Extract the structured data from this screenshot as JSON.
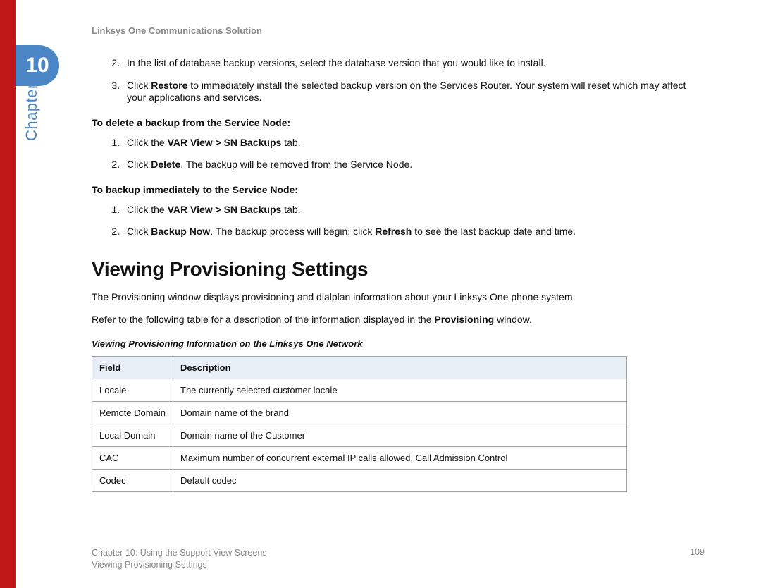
{
  "chapter": {
    "number": "10",
    "label": "Chapter"
  },
  "header": {
    "doc_title": "Linksys One Communications Solution"
  },
  "continued_steps": {
    "s2": "In the list of database backup versions, select the database version that you would like to install.",
    "s3_pre": "Click ",
    "s3_bold": "Restore",
    "s3_post": " to immediately install the selected backup version on the Services Router. Your system will reset which may affect your applications and services."
  },
  "delete_section": {
    "heading": "To delete a backup from the Service Node:",
    "s1_pre": "Click the ",
    "s1_bold": "VAR View > SN Backups",
    "s1_post": " tab.",
    "s2_pre": "Click ",
    "s2_bold": "Delete",
    "s2_post": ". The backup will be removed from the Service Node."
  },
  "backup_now_section": {
    "heading": "To backup immediately to the Service Node:",
    "s1_pre": "Click the ",
    "s1_bold": "VAR View > SN Backups",
    "s1_post": " tab.",
    "s2_pre": "Click ",
    "s2_bold1": "Backup Now",
    "s2_mid": ". The backup process will begin; click ",
    "s2_bold2": "Refresh",
    "s2_post": " to see the last backup date and time."
  },
  "provisioning": {
    "heading": "Viewing Provisioning Settings",
    "p1": "The Provisioning window displays provisioning and dialplan information about your Linksys One phone system.",
    "p2_pre": "Refer to the following table for a description of the information displayed in the ",
    "p2_bold": "Provisioning",
    "p2_post": " window.",
    "table_caption": "Viewing Provisioning Information on the Linksys One Network",
    "col_field": "Field",
    "col_desc": "Description",
    "rows": [
      {
        "field": "Locale",
        "desc": "The currently selected customer locale"
      },
      {
        "field": "Remote Domain",
        "desc": "Domain name of the brand"
      },
      {
        "field": "Local Domain",
        "desc": "Domain name of the Customer"
      },
      {
        "field": "CAC",
        "desc": "Maximum number of concurrent external IP calls allowed, Call Admission Control"
      },
      {
        "field": "Codec",
        "desc": "Default codec"
      }
    ]
  },
  "footer": {
    "chapter_line": "Chapter 10: Using the Support View Screens",
    "section_line": "Viewing Provisioning Settings",
    "page_number": "109"
  }
}
